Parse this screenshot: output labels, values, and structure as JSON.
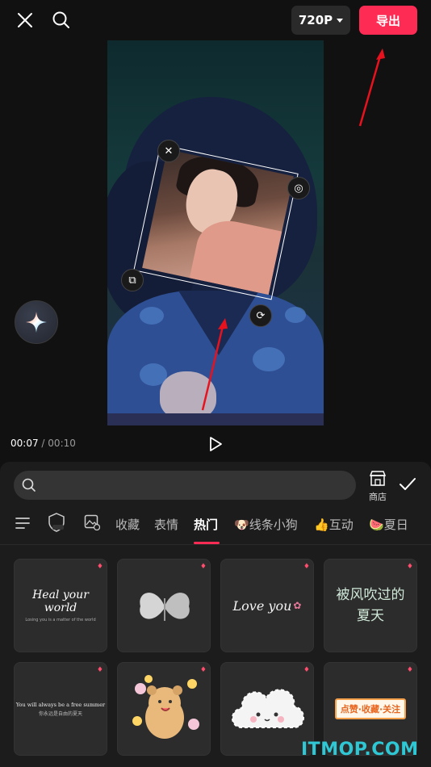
{
  "topbar": {
    "close_icon": "close-icon",
    "search_icon": "search-icon",
    "resolution": "720P",
    "export_label": "导出"
  },
  "preview": {
    "current_time": "00:07",
    "total_time": "00:10",
    "separator": "/"
  },
  "panel": {
    "search_placeholder": "",
    "store_label": "商店",
    "tabs": [
      {
        "label": "收藏"
      },
      {
        "label": "表情"
      },
      {
        "label": "热门"
      },
      {
        "label": "线条小狗"
      },
      {
        "label": "互动"
      },
      {
        "label": "夏日"
      }
    ],
    "stickers": [
      {
        "text": "Heal your world",
        "sub": "Losing you is a matter of the world"
      },
      {
        "text": "",
        "kind": "butterfly"
      },
      {
        "text": "Love you"
      },
      {
        "text": "被风吹过的夏天"
      },
      {
        "text": "You will always be a free summer",
        "sub": "你永远是自由的夏天"
      },
      {
        "text": "",
        "kind": "bear"
      },
      {
        "text": "",
        "kind": "cloud"
      },
      {
        "text": "点赞·收藏·关注"
      }
    ]
  },
  "watermark": "ITMOP.COM",
  "colors": {
    "accent": "#fe2c55",
    "panel": "#1c1c1c"
  }
}
